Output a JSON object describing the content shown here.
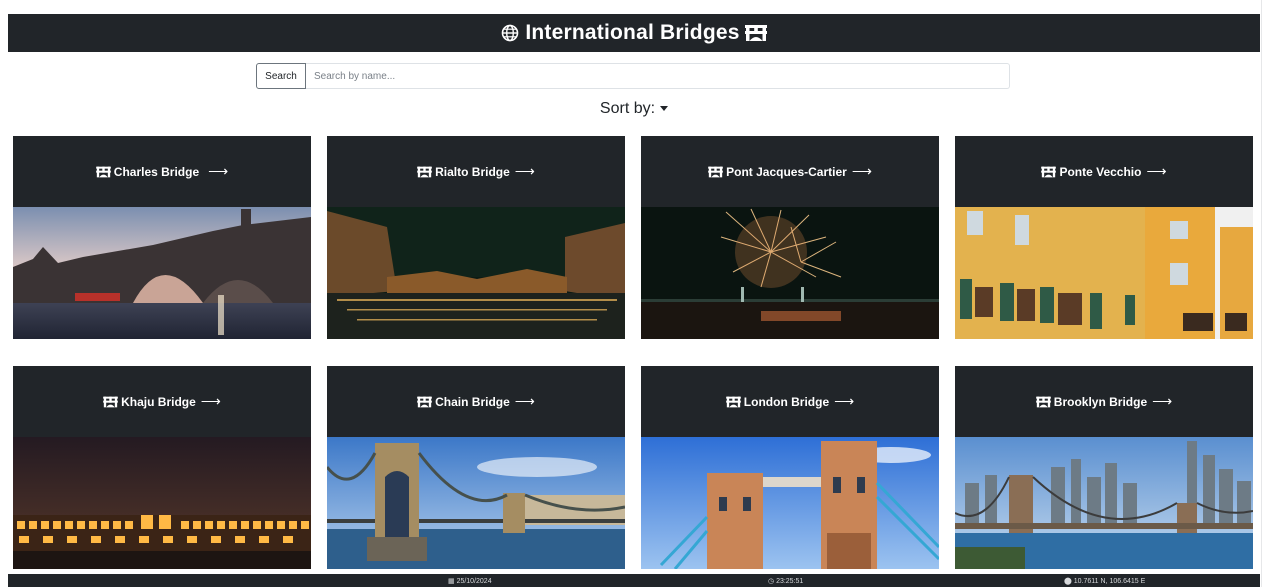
{
  "header": {
    "title": "International Bridges",
    "globe_icon": "globe-icon",
    "bridge_icon": "bridge-icon"
  },
  "search": {
    "button_label": "Search",
    "placeholder": "Search by name..."
  },
  "sort": {
    "label": "Sort by:"
  },
  "cards": [
    {
      "name": "Charles Bridge",
      "arrow": "⟶",
      "image": "charles-bridge-photo"
    },
    {
      "name": "Rialto Bridge",
      "arrow": "⟶",
      "image": "rialto-bridge-photo"
    },
    {
      "name": "Pont Jacques-Cartier",
      "arrow": "⟶",
      "image": "pont-jacques-cartier-photo"
    },
    {
      "name": "Ponte Vecchio",
      "arrow": "⟶",
      "image": "ponte-vecchio-photo"
    },
    {
      "name": "Khaju Bridge",
      "arrow": "⟶",
      "image": "khaju-bridge-photo"
    },
    {
      "name": "Chain Bridge",
      "arrow": "⟶",
      "image": "chain-bridge-photo"
    },
    {
      "name": "London Bridge",
      "arrow": "⟶",
      "image": "london-bridge-photo"
    },
    {
      "name": "Brooklyn Bridge",
      "arrow": "⟶",
      "image": "brooklyn-bridge-photo"
    }
  ],
  "footer": {
    "date": "25/10/2024",
    "time": "23:25:51",
    "coords": "10.7611 N, 106.6415 E"
  },
  "colors": {
    "dark": "#212529",
    "white": "#ffffff"
  }
}
